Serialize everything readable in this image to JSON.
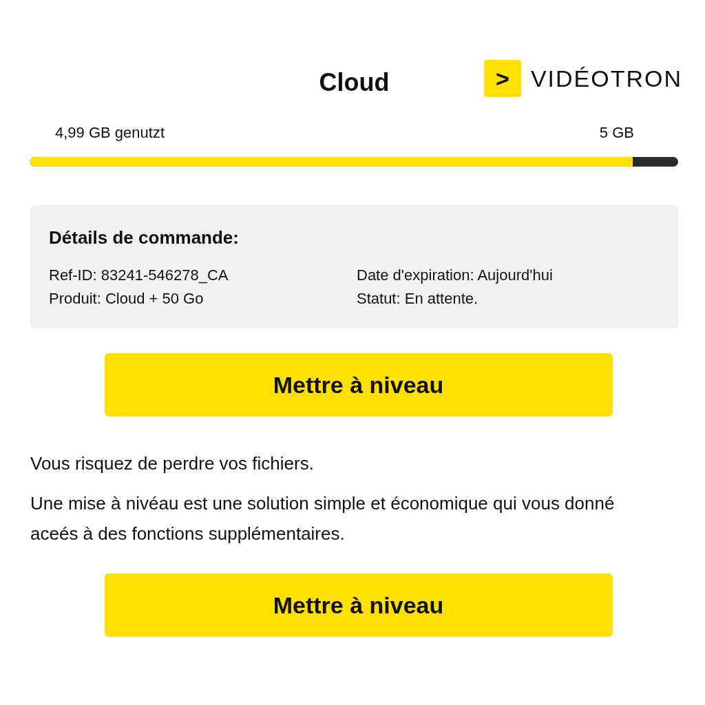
{
  "header": {
    "title": "Cloud",
    "logo_text": "VIDÉOTRON",
    "logo_mark": ">"
  },
  "usage": {
    "used_label": "4,99 GB genutzt",
    "total_label": "5 GB",
    "level": 0.93
  },
  "order_details": {
    "heading": "Détails de commande:",
    "fields": [
      {
        "text": "Ref-ID: 83241-546278_CA"
      },
      {
        "text": "Date d'expiration: Aujourd'hui"
      },
      {
        "text": "Produit: Cloud + 50 Go"
      },
      {
        "text": "Statut: En attente."
      }
    ]
  },
  "upgrade_button_top": "Mettre à niveau",
  "paragraphs": [
    "Vous risquez de perdre vos fichiers.",
    "Une mise à nivéau est une solution simple et économique qui vous donné aceés à des fonctions supplémentaires."
  ],
  "upgrade_button_bottom": "Mettre à niveau"
}
